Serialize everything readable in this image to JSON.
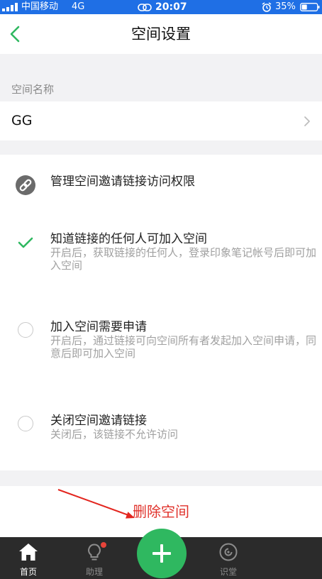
{
  "status_bar": {
    "carrier": "中国移动",
    "network": "4G",
    "time": "20:07",
    "battery": "35%",
    "icons": [
      "signal-icon",
      "link-icon",
      "alarm-icon",
      "battery-icon"
    ]
  },
  "header": {
    "title": "空间设置",
    "back_icon": "chevron-left-icon"
  },
  "space_name": {
    "label": "空间名称",
    "value": "GG",
    "chevron_icon": "chevron-right-icon"
  },
  "invite_access": {
    "title": "管理空间邀请链接访问权限",
    "icon": "link-icon",
    "options": [
      {
        "title": "知道链接的任何人可加入空间",
        "desc": "开启后，获取链接的任何人，登录印象笔记帐号后即可加入空间",
        "selected": true
      },
      {
        "title": "加入空间需要申请",
        "desc": "开启后，通过链接可向空间所有者发起加入空间申请，同意后即可加入空间",
        "selected": false
      },
      {
        "title": "关闭空间邀请链接",
        "desc": "关闭后，该链接不允许访问",
        "selected": false
      }
    ]
  },
  "delete_space": {
    "label": "删除空间"
  },
  "tab_bar": {
    "items": [
      {
        "label": "首页",
        "icon": "home-icon",
        "active": true,
        "badge": false
      },
      {
        "label": "助理",
        "icon": "lightbulb-icon",
        "active": false,
        "badge": true
      },
      {
        "label": "识堂",
        "icon": "swirl-icon",
        "active": false,
        "badge": false
      }
    ],
    "center_button_icon": "plus-icon"
  },
  "colors": {
    "status_bar": "#1f6fe5",
    "accent_green": "#2fb860",
    "delete_red": "#e0322b",
    "tab_bar": "#2b2b2b",
    "badge_red": "#e8443a",
    "annotation_arrow": "#e3261f"
  }
}
